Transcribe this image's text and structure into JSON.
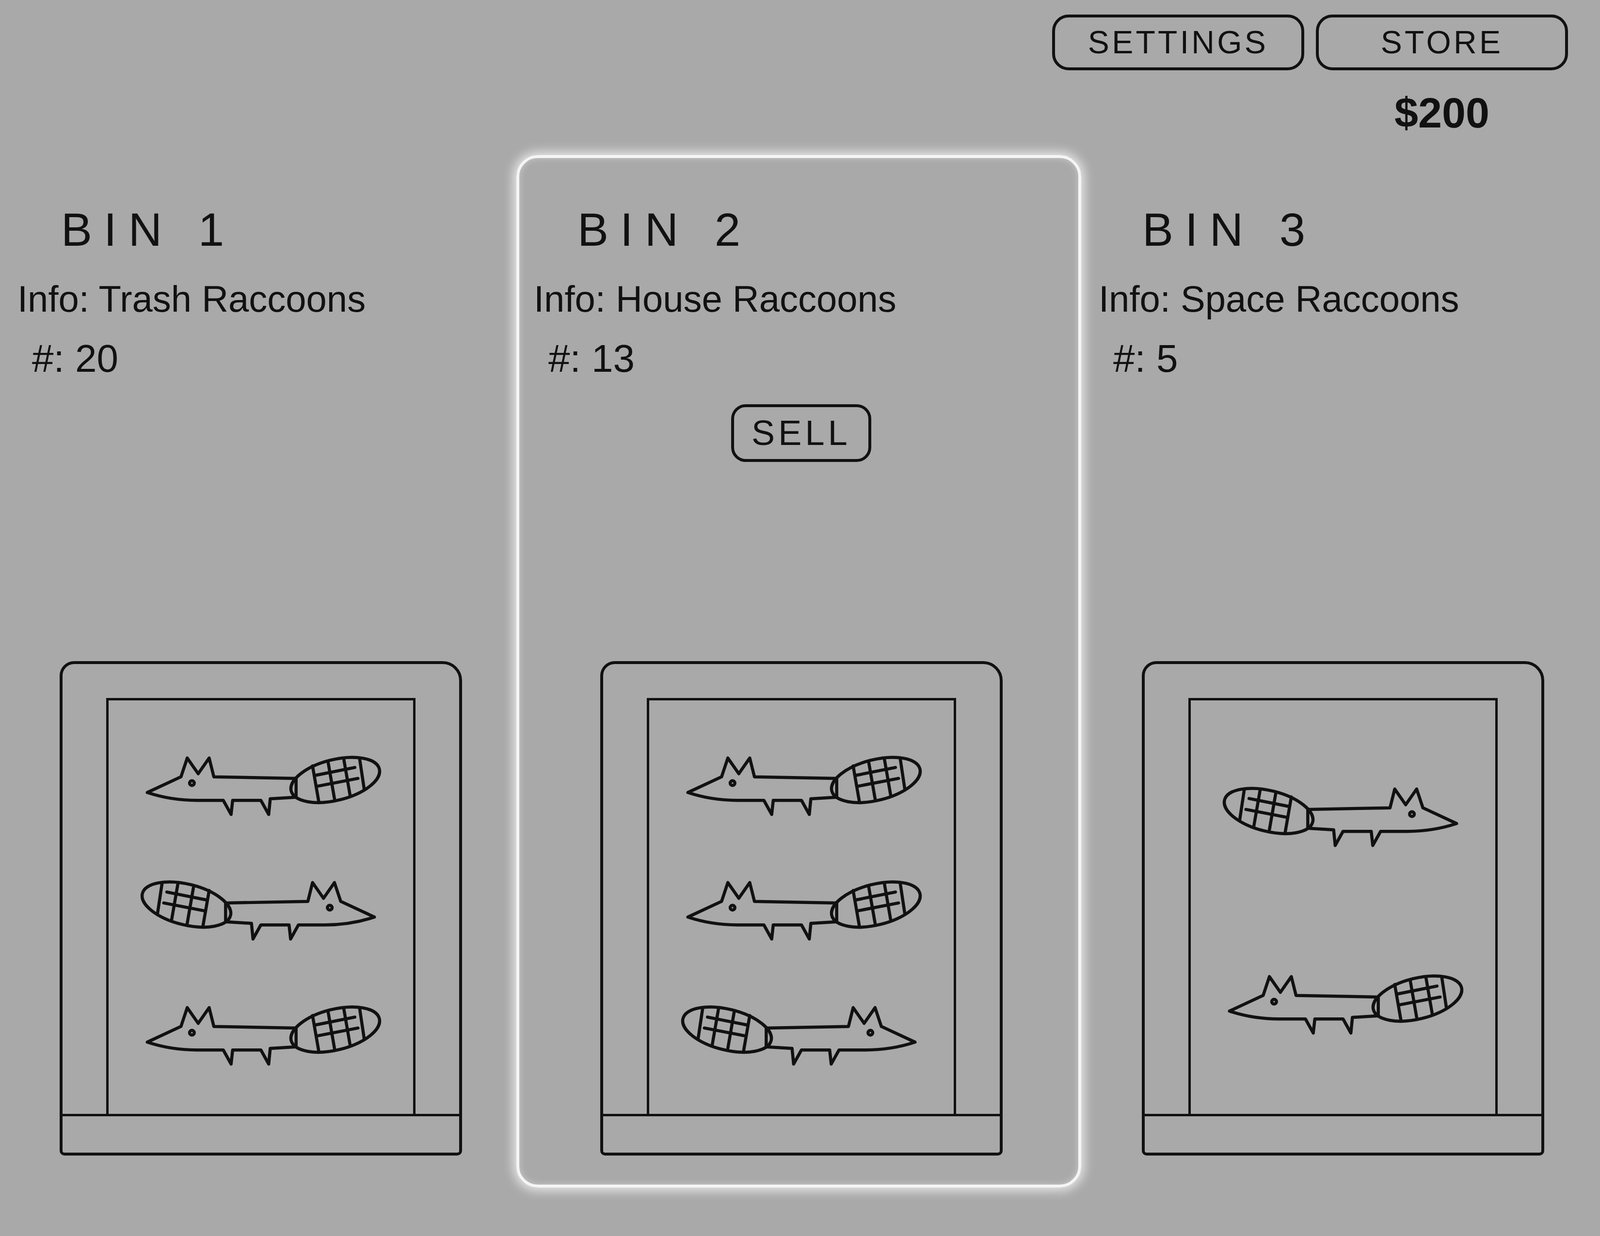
{
  "toolbar": {
    "settings": "SETTINGS",
    "store": "STORE",
    "money": "$200"
  },
  "bins": [
    {
      "title": "BIN 1",
      "info": "Info: Trash Raccoons",
      "count": "#: 20",
      "selected": false
    },
    {
      "title": "BIN 2",
      "info": "Info: House Raccoons",
      "count": "#: 13",
      "selected": true
    },
    {
      "title": "BIN 3",
      "info": "Info: Space Raccoons",
      "count": "#: 5",
      "selected": false
    }
  ],
  "sell_label": "SELL"
}
